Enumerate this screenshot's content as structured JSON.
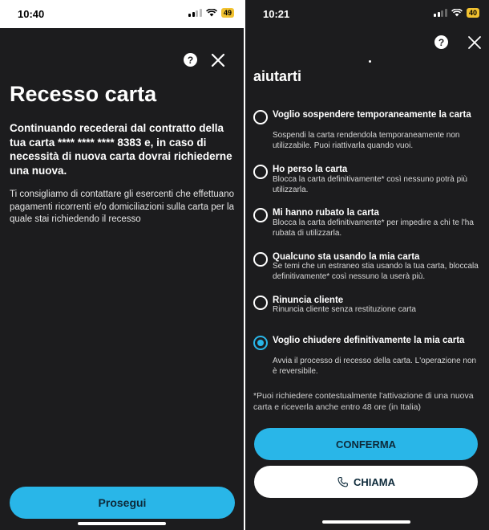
{
  "left": {
    "status": {
      "time": "10:40",
      "battery": "49"
    },
    "title": "Recesso carta",
    "lead": "Continuando recederai dal contratto della tua carta **** **** **** 8383 e, in caso di necessità di nuova carta dovrai richiederne una nuova.",
    "body": "Ti consigliamo di contattare gli esercenti che effettuano pagamenti ricorrenti e/o domiciliazioni sulla carta per la quale stai richiedendo il recesso",
    "continue_label": "Prosegui"
  },
  "right": {
    "status": {
      "time": "10:21",
      "battery": "40"
    },
    "title": "aiutarti",
    "options": [
      {
        "title": "Voglio sospendere temporaneamente la carta",
        "desc": "Sospendi la carta rendendola temporaneamente non utilizzabile. Puoi riattivarla quando vuoi.",
        "selected": false
      },
      {
        "title": "Ho perso la carta",
        "desc": "Blocca la carta definitivamente* così nessuno potrà più utilizzarla.",
        "selected": false
      },
      {
        "title": "Mi hanno rubato la carta",
        "desc": "Blocca la carta definitivamente* per impedire a chi te l'ha rubata di utilizzarla.",
        "selected": false
      },
      {
        "title": "Qualcuno sta usando la mia carta",
        "desc": "Se temi che un estraneo stia usando la tua carta, bloccala definitivamente* così nessuno la userà più.",
        "selected": false
      },
      {
        "title": "Rinuncia cliente",
        "desc": "Rinuncia cliente senza restituzione carta",
        "selected": false
      },
      {
        "title": "Voglio chiudere definitivamente la mia carta",
        "desc": "Avvia il processo di recesso della carta. L'operazione non è reversibile.",
        "selected": true
      }
    ],
    "footnote": "*Puoi richiedere contestualmente l'attivazione di una nuova carta e riceverla anche entro 48 ore (in Italia)",
    "confirm_label": "CONFERMA",
    "call_label": "CHIAMA"
  },
  "colors": {
    "accent": "#29b6e8",
    "background": "#1c1c1e",
    "battery": "#f2c230"
  },
  "icons": [
    "help-icon",
    "close-icon",
    "phone-icon",
    "wifi-icon",
    "signal-icon",
    "battery-icon"
  ]
}
